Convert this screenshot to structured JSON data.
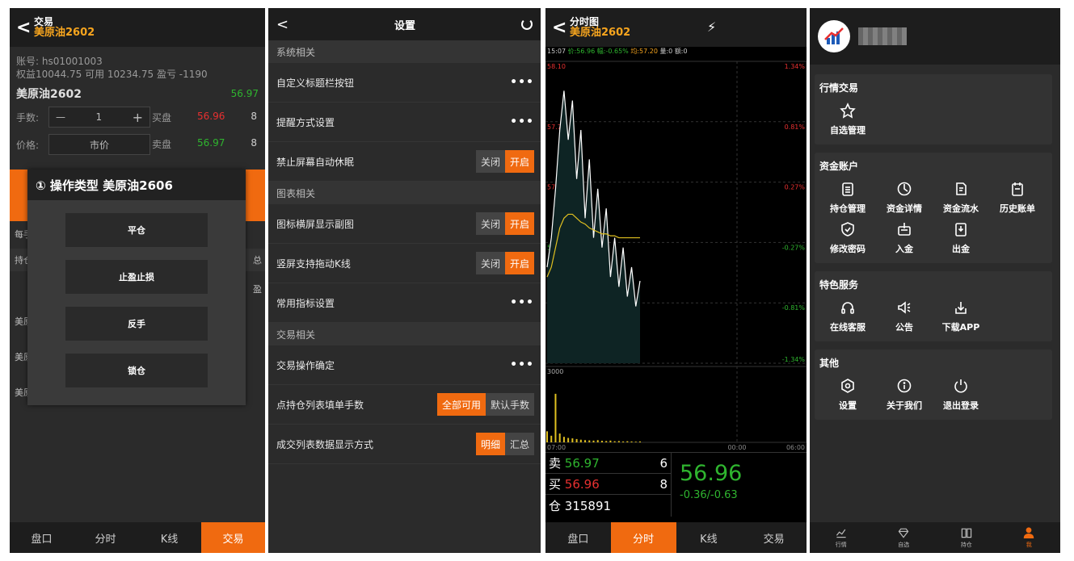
{
  "screen1": {
    "header": {
      "title": "交易",
      "subtitle": "美原油2602"
    },
    "account_line": "账号: hs01001003",
    "equity_line": "权益10044.75 可用 10234.75 盈亏 -1190",
    "instrument": "美原油2602",
    "last_price": "56.97",
    "qty_label": "手数:",
    "qty_minus": "—",
    "qty_value": "1",
    "qty_plus": "+",
    "price_label": "价格:",
    "price_value": "市价",
    "bid_label": "买盘",
    "bid_price": "56.96",
    "bid_vol": "8",
    "ask_label": "卖盘",
    "ask_price": "56.97",
    "ask_vol": "8",
    "bg_fragments": {
      "each": "每手",
      "hold": "持仓",
      "total": "总",
      "profit": "盈",
      "row": "美原"
    },
    "modal": {
      "title": "① 操作类型 美原油2606",
      "buttons": [
        "平仓",
        "止盈止损",
        "反手",
        "锁仓"
      ]
    },
    "tabs": [
      "盘口",
      "分时",
      "K线",
      "交易"
    ],
    "active_tab": 3
  },
  "screen2": {
    "header": {
      "title": "设置"
    },
    "sections": [
      {
        "title": "系统相关",
        "rows": [
          {
            "label": "自定义标题栏按钮",
            "type": "more"
          },
          {
            "label": "提醒方式设置",
            "type": "more"
          },
          {
            "label": "禁止屏幕自动休眠",
            "type": "seg",
            "options": [
              "关闭",
              "开启"
            ],
            "on": 1
          }
        ]
      },
      {
        "title": "图表相关",
        "rows": [
          {
            "label": "图标横屏显示副图",
            "type": "seg",
            "options": [
              "关闭",
              "开启"
            ],
            "on": 1
          },
          {
            "label": "竖屏支持拖动K线",
            "type": "seg",
            "options": [
              "关闭",
              "开启"
            ],
            "on": 1
          },
          {
            "label": "常用指标设置",
            "type": "more"
          }
        ]
      },
      {
        "title": "交易相关",
        "rows": [
          {
            "label": "交易操作确定",
            "type": "more"
          },
          {
            "label": "点持仓列表填单手数",
            "type": "seg",
            "options": [
              "全部可用",
              "默认手数"
            ],
            "on": 0
          },
          {
            "label": "成交列表数据显示方式",
            "type": "seg",
            "options": [
              "明细",
              "汇总"
            ],
            "on": 0
          }
        ]
      }
    ],
    "more_glyph": "•••"
  },
  "screen3": {
    "header": {
      "title": "分时图",
      "subtitle": "美原油2602"
    },
    "infobar": {
      "time": "15:07",
      "price": "价:56.96",
      "change": "幅:-0.65%",
      "avg": "均:57.20",
      "hold": "量:0",
      "inc": "额:0"
    },
    "price_labels": [
      "58.10",
      "57.79",
      "57.48",
      "57.18",
      "56.87",
      "56.56"
    ],
    "pct_labels": [
      "1.34%",
      "0.81%",
      "0.27%",
      "-0.27%",
      "-0.81%",
      "-1.34%"
    ],
    "volume_top": "3000",
    "time_labels": [
      "07:00",
      "00:00",
      "06:00"
    ],
    "chart_data": {
      "type": "line",
      "ylim": [
        56.56,
        58.1
      ],
      "price": [
        57.05,
        57.2,
        57.45,
        57.75,
        57.95,
        57.7,
        57.9,
        57.5,
        57.75,
        57.3,
        57.6,
        57.2,
        57.45,
        57.15,
        57.35,
        57.0,
        57.2,
        56.95,
        57.15,
        56.9,
        57.05,
        56.85,
        56.98
      ],
      "avg": [
        57.0,
        57.05,
        57.15,
        57.25,
        57.3,
        57.32,
        57.32,
        57.3,
        57.28,
        57.27,
        57.25,
        57.24,
        57.23,
        57.22,
        57.22,
        57.21,
        57.21,
        57.2,
        57.2,
        57.2,
        57.2,
        57.2,
        57.2
      ],
      "volume_max": 3000,
      "volume": [
        500,
        300,
        2200,
        400,
        250,
        200,
        180,
        150,
        120,
        100,
        90,
        80,
        100,
        70,
        60,
        80,
        50,
        60,
        40,
        50,
        40,
        30,
        40
      ]
    },
    "quote": {
      "sell_label": "卖",
      "sell_price": "56.97",
      "sell_vol": "6",
      "buy_label": "买",
      "buy_price": "56.96",
      "buy_vol": "8",
      "oi_label": "仓",
      "oi_value": "315891",
      "last": "56.96",
      "change": "-0.36/-0.63"
    },
    "tabs": [
      "盘口",
      "分时",
      "K线",
      "交易"
    ],
    "active_tab": 1
  },
  "screen4": {
    "cards": [
      {
        "title": "行情交易",
        "items": [
          {
            "label": "自选管理",
            "icon": "star-icon"
          }
        ]
      },
      {
        "title": "资金账户",
        "items": [
          {
            "label": "持仓管理",
            "icon": "clipboard-icon"
          },
          {
            "label": "资金详情",
            "icon": "pie-icon"
          },
          {
            "label": "资金流水",
            "icon": "notes-icon"
          },
          {
            "label": "历史账单",
            "icon": "bill-icon"
          },
          {
            "label": "修改密码",
            "icon": "shield-icon"
          },
          {
            "label": "入金",
            "icon": "deposit-icon"
          },
          {
            "label": "出金",
            "icon": "withdraw-icon"
          }
        ]
      },
      {
        "title": "特色服务",
        "items": [
          {
            "label": "在线客服",
            "icon": "headset-icon"
          },
          {
            "label": "公告",
            "icon": "speaker-icon"
          },
          {
            "label": "下载APP",
            "icon": "download-icon"
          }
        ]
      },
      {
        "title": "其他",
        "items": [
          {
            "label": "设置",
            "icon": "gear-icon"
          },
          {
            "label": "关于我们",
            "icon": "info-icon"
          },
          {
            "label": "退出登录",
            "icon": "power-icon"
          }
        ]
      }
    ],
    "tabs": [
      {
        "label": "行情",
        "icon": "chart-icon"
      },
      {
        "label": "自选",
        "icon": "diamond-icon"
      },
      {
        "label": "持仓",
        "icon": "book-icon"
      },
      {
        "label": "我",
        "icon": "user-icon"
      }
    ],
    "active_tab": 3
  }
}
